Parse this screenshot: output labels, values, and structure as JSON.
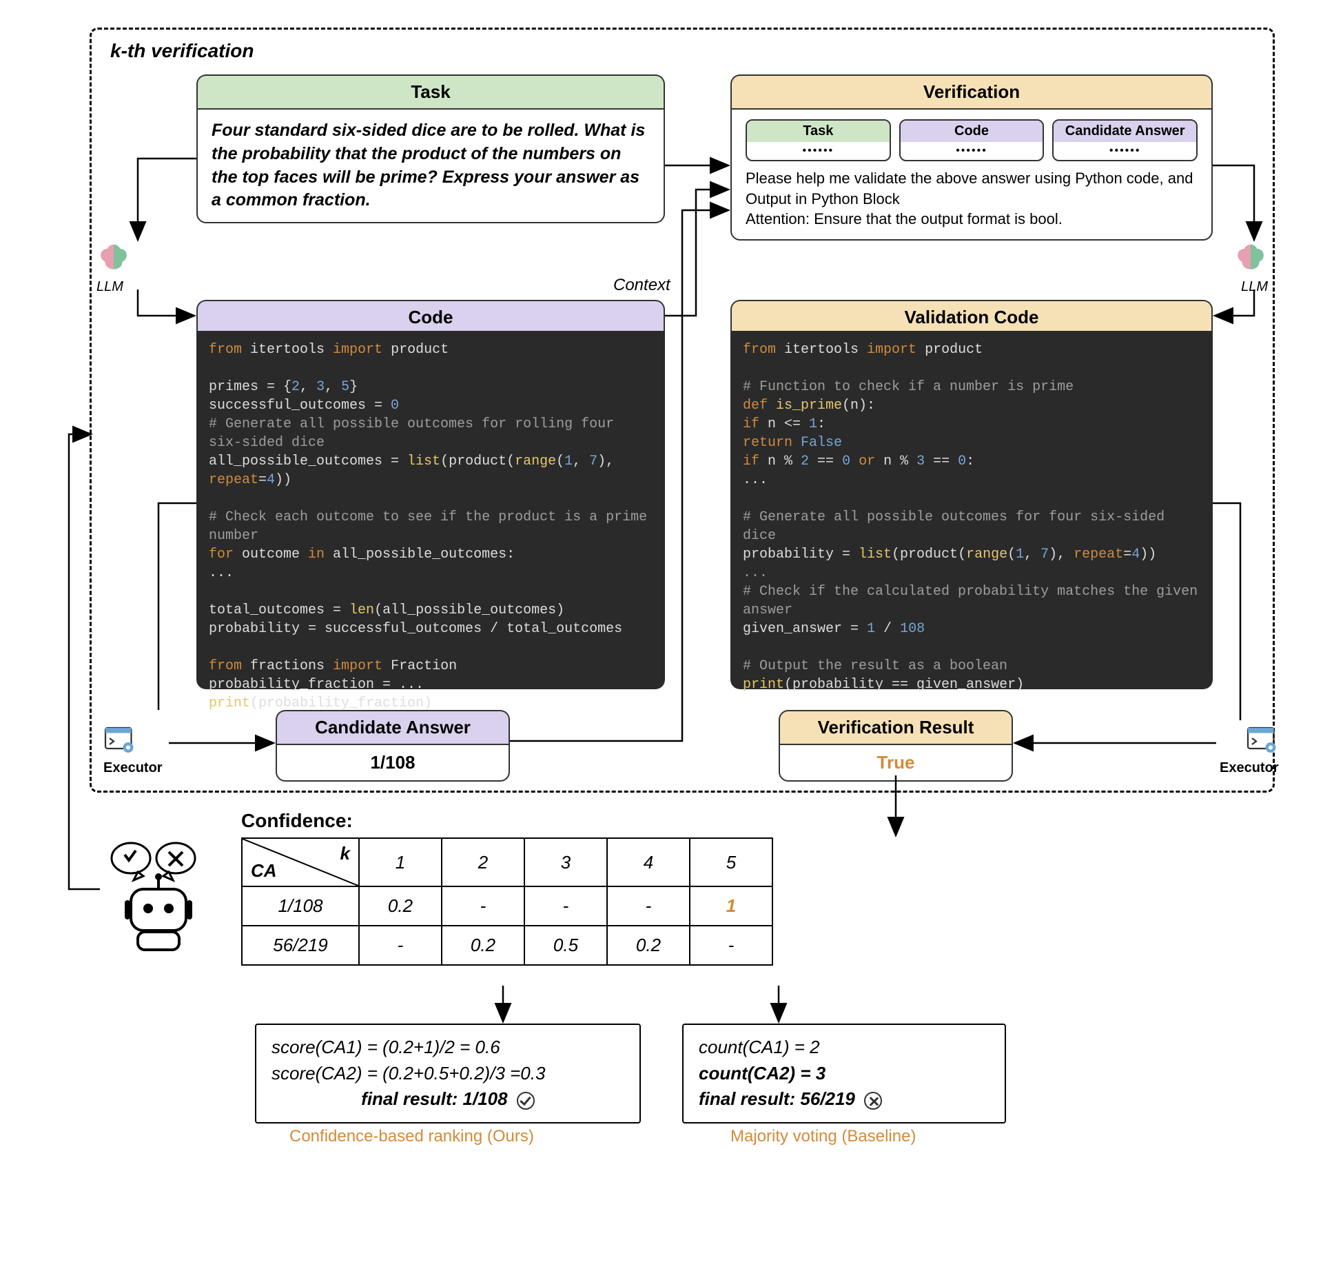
{
  "title": "k-th verification",
  "task": {
    "header": "Task",
    "text": "Four standard six-sided dice are to be rolled. What is the probability that the product of the numbers on the top faces will be prime? Express your answer as a common fraction."
  },
  "code_header": "Code",
  "verification": {
    "header": "Verification",
    "mini_task": "Task",
    "mini_code": "Code",
    "mini_ca": "Candidate Answer",
    "dots": "••••••",
    "text1": "Please help me validate the above answer using Python code, and Output in Python Block",
    "text2": "Attention: Ensure that the output format is bool."
  },
  "validation_header": "Validation Code",
  "candidate": {
    "header": "Candidate Answer",
    "value": "1/108"
  },
  "result": {
    "header": "Verification Result",
    "value": "True"
  },
  "llm_label": "LLM",
  "executor_label": "Executor",
  "context_label": "Context",
  "code_lines": {
    "l1a": "from ",
    "l1b": "itertools ",
    "l1c": "import ",
    "l1d": "product",
    "l2a": "primes = {",
    "l2b": "2",
    "l2c": ", ",
    "l2d": "3",
    "l2e": ", ",
    "l2f": "5",
    "l2g": "}",
    "l3a": "successful_outcomes = ",
    "l3b": "0",
    "l4": "# Generate all possible outcomes for rolling four six-sided dice",
    "l5a": "all_possible_outcomes = ",
    "l5b": "list",
    "l5c": "(product(",
    "l5d": "range",
    "l5e": "(",
    "l5f": "1",
    "l5g": ", ",
    "l5h": "7",
    "l5i": "), ",
    "l5j": "repeat",
    "l5k": "=",
    "l5l": "4",
    "l5m": "))",
    "l6": "# Check each outcome to see if the product is a prime number",
    "l7a": "for ",
    "l7b": "outcome ",
    "l7c": "in ",
    "l7d": "all_possible_outcomes:",
    "l8": "    ...",
    "l9a": "total_outcomes = ",
    "l9b": "len",
    "l9c": "(all_possible_outcomes)",
    "l10": "probability = successful_outcomes / total_outcomes",
    "l11a": "from ",
    "l11b": "fractions ",
    "l11c": "import ",
    "l11d": "Fraction",
    "l12": "probability_fraction = ...",
    "l13a": "print",
    "l13b": "(probability_fraction)"
  },
  "vcode_lines": {
    "l1a": "from ",
    "l1b": "itertools ",
    "l1c": "import ",
    "l1d": "product",
    "l2": "# Function to check if a number is prime",
    "l3a": "def ",
    "l3b": "is_prime",
    "l3c": "(n):",
    "l4a": "    if ",
    "l4b": "n <= ",
    "l4c": "1",
    "l4d": ":",
    "l5a": "        return ",
    "l5b": "False",
    "l6a": "    if ",
    "l6b": "n % ",
    "l6c": "2",
    "l6d": " == ",
    "l6e": "0",
    "l6f": " or ",
    "l6g": "n % ",
    "l6h": "3",
    "l6i": " == ",
    "l6j": "0",
    "l6k": ":",
    "l7": "        ...",
    "l8": "# Generate all possible outcomes for four six-sided dice",
    "l9a": "probability = ",
    "l9b": "list",
    "l9c": "(product(",
    "l9d": "range",
    "l9e": "(",
    "l9f": "1",
    "l9g": ", ",
    "l9h": "7",
    "l9i": "), ",
    "l9j": "repeat",
    "l9k": "=",
    "l9l": "4",
    "l9m": "))",
    "l10": "...",
    "l11": "# Check if the calculated probability matches the given answer",
    "l12a": "given_answer = ",
    "l12b": "1",
    "l12c": " / ",
    "l12d": "108",
    "l13": "# Output the result as a boolean",
    "l14a": "print",
    "l14b": "(probability == given_answer)"
  },
  "confidence": {
    "title": "Confidence:",
    "k_label": "k",
    "ca_label": "CA",
    "columns": [
      "1",
      "2",
      "3",
      "4",
      "5"
    ],
    "rows": [
      {
        "label": "1/108",
        "values": [
          "0.2",
          "-",
          "-",
          "-",
          "1"
        ]
      },
      {
        "label": "56/219",
        "values": [
          "-",
          "0.2",
          "0.5",
          "0.2",
          "-"
        ]
      }
    ]
  },
  "scores": {
    "ours1": "score(CA1) = (0.2+1)/2 = 0.6",
    "ours2": "score(CA2) = (0.2+0.5+0.2)/3 =0.3",
    "ours_final": "final result:  1/108",
    "ours_caption": "Confidence-based ranking  (Ours)",
    "base1": "count(CA1) = 2",
    "base2": "count(CA2) = 3",
    "base_final": "final result:  56/219",
    "base_caption": "Majority voting (Baseline)"
  }
}
